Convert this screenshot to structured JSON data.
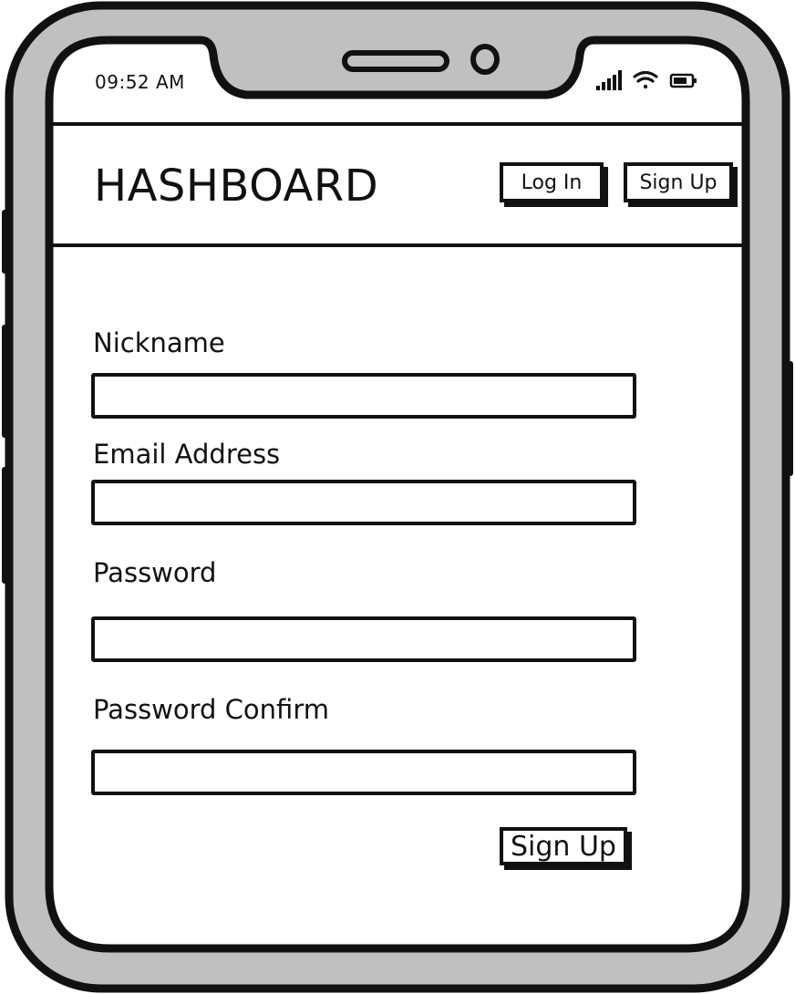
{
  "status_bar": {
    "time": "09:52 AM",
    "icons": [
      "cellular-signal-icon",
      "wifi-icon",
      "battery-icon"
    ]
  },
  "header": {
    "brand": "HASHBOARD",
    "login_label": "Log In",
    "signup_label": "Sign Up"
  },
  "form": {
    "fields": [
      {
        "label": "Nickname",
        "value": ""
      },
      {
        "label": "Email Address",
        "value": ""
      },
      {
        "label": "Password",
        "value": ""
      },
      {
        "label": "Password Confirm",
        "value": ""
      }
    ],
    "submit_label": "Sign Up"
  },
  "colors": {
    "frame_gray": "#c0c0c0",
    "ink": "#111111",
    "screen": "#ffffff"
  }
}
